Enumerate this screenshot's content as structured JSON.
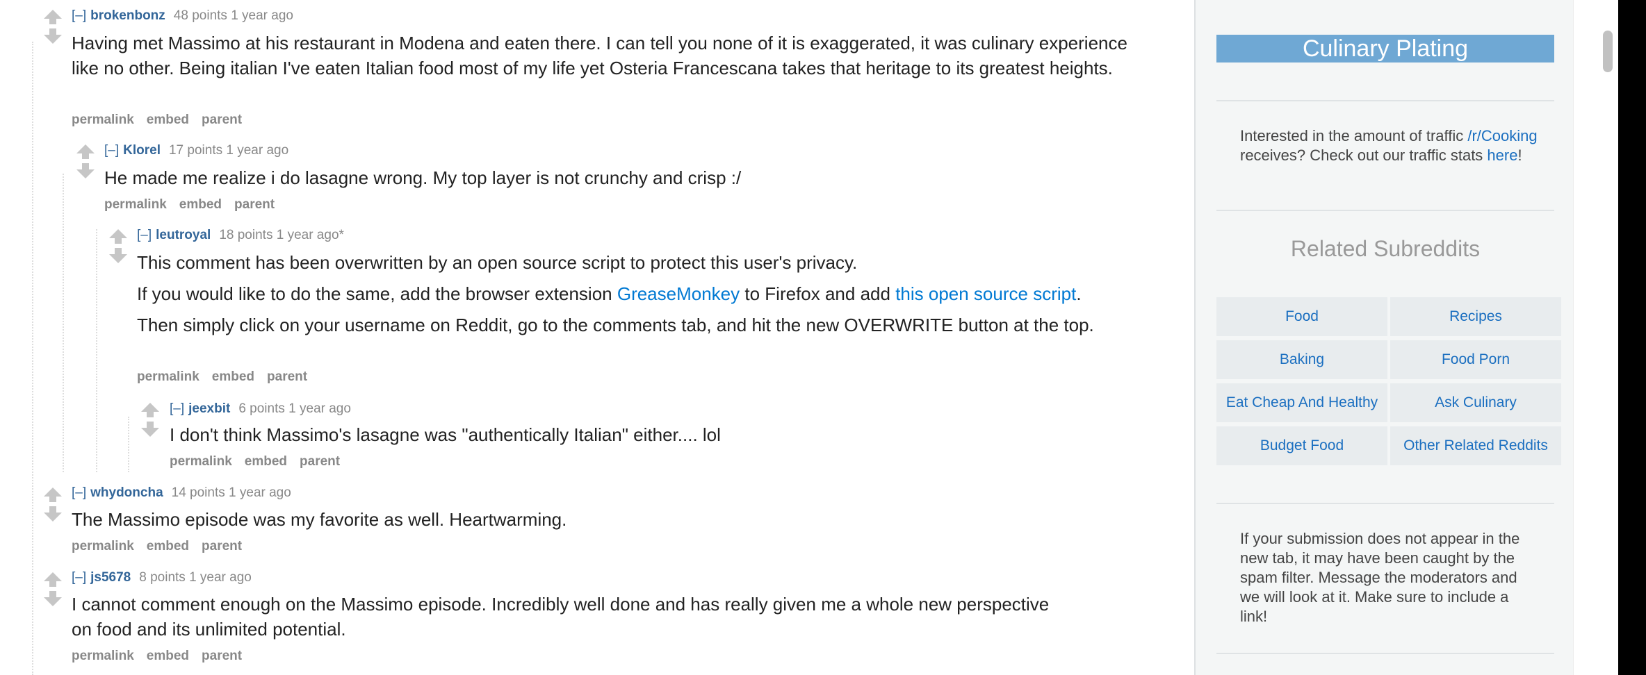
{
  "comments": [
    {
      "collapse": "[–]",
      "author": "brokenbonz",
      "score": "48 points 1 year ago",
      "body": [
        "Having met Massimo at his restaurant in Modena and eaten there. I can tell you none of it is exaggerated, it was culinary experience like no other. Being italian I've eaten Italian food most of my life yet Osteria Francescana takes that heritage to its greatest heights."
      ],
      "buttons": [
        "permalink",
        "embed",
        "parent"
      ]
    },
    {
      "collapse": "[–]",
      "author": "Klorel",
      "score": "17 points 1 year ago",
      "body": [
        "He made me realize i do lasagne wrong. My top layer is not crunchy and crisp :/"
      ],
      "buttons": [
        "permalink",
        "embed",
        "parent"
      ]
    },
    {
      "collapse": "[–]",
      "author": "leutroyal",
      "score": "18 points 1 year ago*",
      "body_p1": "This comment has been overwritten by an open source script to protect this user's privacy.",
      "body_p2_a": "If you would like to do the same, add the browser extension ",
      "body_p2_link1": "GreaseMonkey",
      "body_p2_b": " to Firefox and add ",
      "body_p2_link2": "this open source script",
      "body_p2_c": ".",
      "body_p3": "Then simply click on your username on Reddit, go to the comments tab, and hit the new OVERWRITE button at the top.",
      "buttons": [
        "permalink",
        "embed",
        "parent"
      ]
    },
    {
      "collapse": "[–]",
      "author": "jeexbit",
      "score": "6 points 1 year ago",
      "body": [
        "I don't think Massimo's lasagne was \"authentically Italian\" either.... lol"
      ],
      "buttons": [
        "permalink",
        "embed",
        "parent"
      ]
    },
    {
      "collapse": "[–]",
      "author": "whydoncha",
      "score": "14 points 1 year ago",
      "body": [
        "The Massimo episode was my favorite as well. Heartwarming."
      ],
      "buttons": [
        "permalink",
        "embed",
        "parent"
      ]
    },
    {
      "collapse": "[–]",
      "author": "js5678",
      "score": "8 points 1 year ago",
      "body": [
        "I cannot comment enough on the Massimo episode. Incredibly well done and has really given me a whole new perspective on food and its unlimited potential."
      ],
      "buttons": [
        "permalink",
        "embed",
        "parent"
      ]
    }
  ],
  "sidebar": {
    "title": "Culinary Plating",
    "traffic_a": "Interested in the amount of traffic ",
    "traffic_link": "/r/Cooking",
    "traffic_b": " receives? Check out our traffic stats ",
    "traffic_link2": "here",
    "traffic_c": "!",
    "related_heading": "Related Subreddits",
    "related": [
      "Food",
      "Recipes",
      "Baking",
      "Food Porn",
      "Eat Cheap And Healthy",
      "Ask Culinary",
      "Budget Food",
      "Other Related Reddits"
    ],
    "spam_note": "If your submission does not appear in the new tab, it may have been caught by the spam filter. Message the moderators and we will look at it. Make sure to include a link!"
  },
  "colors": {
    "link": "#0079d3",
    "author": "#336699",
    "sidebar_title_bg": "#6fa8d4",
    "sidebar_bg": "#f4f6f6"
  },
  "icons": [
    "upvote-arrow-icon",
    "downvote-arrow-icon"
  ]
}
